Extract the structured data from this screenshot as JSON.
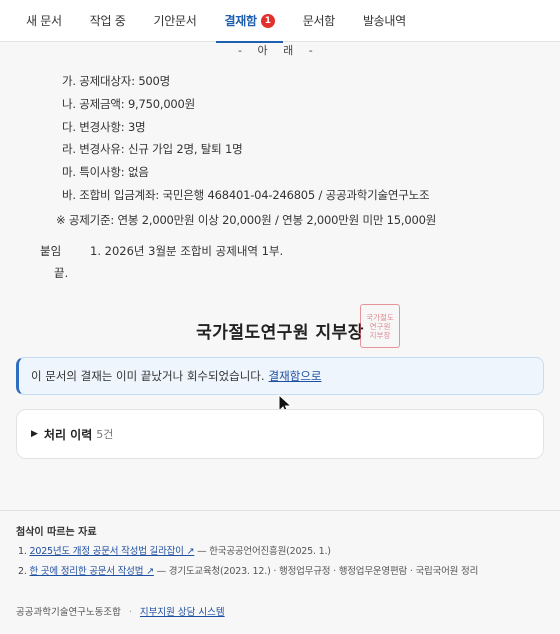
{
  "tabs": [
    {
      "label": "새 문서"
    },
    {
      "label": "작업 중"
    },
    {
      "label": "기안문서"
    },
    {
      "label": "결재함",
      "badge": "1",
      "active": true
    },
    {
      "label": "문서함"
    },
    {
      "label": "발송내역"
    }
  ],
  "document": {
    "arae": "- 아 래 -",
    "items": [
      "가. 공제대상자: 500명",
      "나. 공제금액: 9,750,000원",
      "다. 변경사항: 3명",
      "라. 변경사유: 신규 가입 2명, 탈퇴 1명",
      "마. 특이사항: 없음",
      "바. 조합비 입금계좌: 국민은행 468401-04-246805 / 공공과학기술연구노조"
    ],
    "note": "※ 공제기준: 연봉 2,000만원 이상 20,000원 / 연봉 2,000만원 미만 15,000원",
    "attachment_label": "붙임",
    "attachment_text": "1. 2026년 3월분 조합비 공제내역 1부.",
    "end": "끝.",
    "sender": "국가절도연구원 지부장",
    "seal_text": "국가절도연구원지부장"
  },
  "banner": {
    "text": "이 문서의 결재는 이미 끝났거나 회수되었습니다.",
    "link": "결재함으로"
  },
  "history": {
    "title": "처리 이력",
    "count": "5건"
  },
  "references": {
    "title": "첨삭이 따르는 자료",
    "items": [
      {
        "num": "1.",
        "link": "2025년도 개정 공문서 작성법 길라잡이 ↗",
        "source": "— 한국공공언어진흥원(2025. 1.)"
      },
      {
        "num": "2.",
        "link": "한 곳에 정리한 공문서 작성법 ↗",
        "source": "— 경기도교육청(2023. 12.) · 행정업무규정 · 행정업무운영편람 · 국립국어원 정리"
      }
    ]
  },
  "footer": {
    "org": "공공과학기술연구노동조합",
    "link": "지부지원 상담 시스템"
  },
  "colors": {
    "accent": "#1f5fb0",
    "badge": "#e0312c",
    "seal": "#d7464f",
    "banner_bg": "#eef5fd"
  },
  "icons": [
    "cursor-arrow-icon",
    "triangle-right-icon",
    "external-link-icon"
  ]
}
